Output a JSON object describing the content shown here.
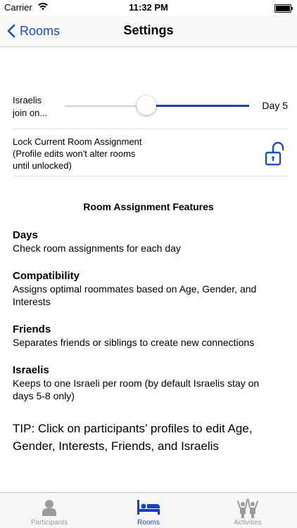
{
  "status_bar": {
    "carrier": "Carrier",
    "time": "11:32 PM"
  },
  "nav": {
    "back_label": "Rooms",
    "title": "Settings"
  },
  "settings": {
    "slider": {
      "label_line1": "Israelis",
      "label_line2": "join on...",
      "value_text": "Day 5",
      "level_fraction": 0.45
    },
    "lock": {
      "line1": "Lock Current Room Assignment",
      "line2": "(Profile edits won't alter rooms",
      "line3": "until unlocked)",
      "icon": "unlocked-padlock-icon"
    }
  },
  "features": {
    "title": "Room Assignment Features",
    "items": [
      {
        "name": "Days",
        "description": "Check room assignments for each day"
      },
      {
        "name": "Compatibility",
        "description": "Assigns optimal roommates based on Age, Gender, and Interests"
      },
      {
        "name": "Friends",
        "description": "Separates friends or siblings to create new connections"
      },
      {
        "name": "Israelis",
        "description": "Keeps to one Israeli per room (by default Israelis stay on days 5-8 only)"
      }
    ]
  },
  "tip": "TIP: Click on participants’ profiles to edit Age, Gender, Interests, Friends, and Israelis",
  "tab_bar": {
    "tabs": [
      {
        "label": "Participants",
        "icon": "person-icon"
      },
      {
        "label": "Rooms",
        "icon": "bed-icon",
        "selected": true
      },
      {
        "label": "Activities",
        "icon": "people-cheering-icon"
      }
    ]
  },
  "colors": {
    "accent": "#1b4bd0",
    "inactive_tab": "#9a9a9f"
  }
}
